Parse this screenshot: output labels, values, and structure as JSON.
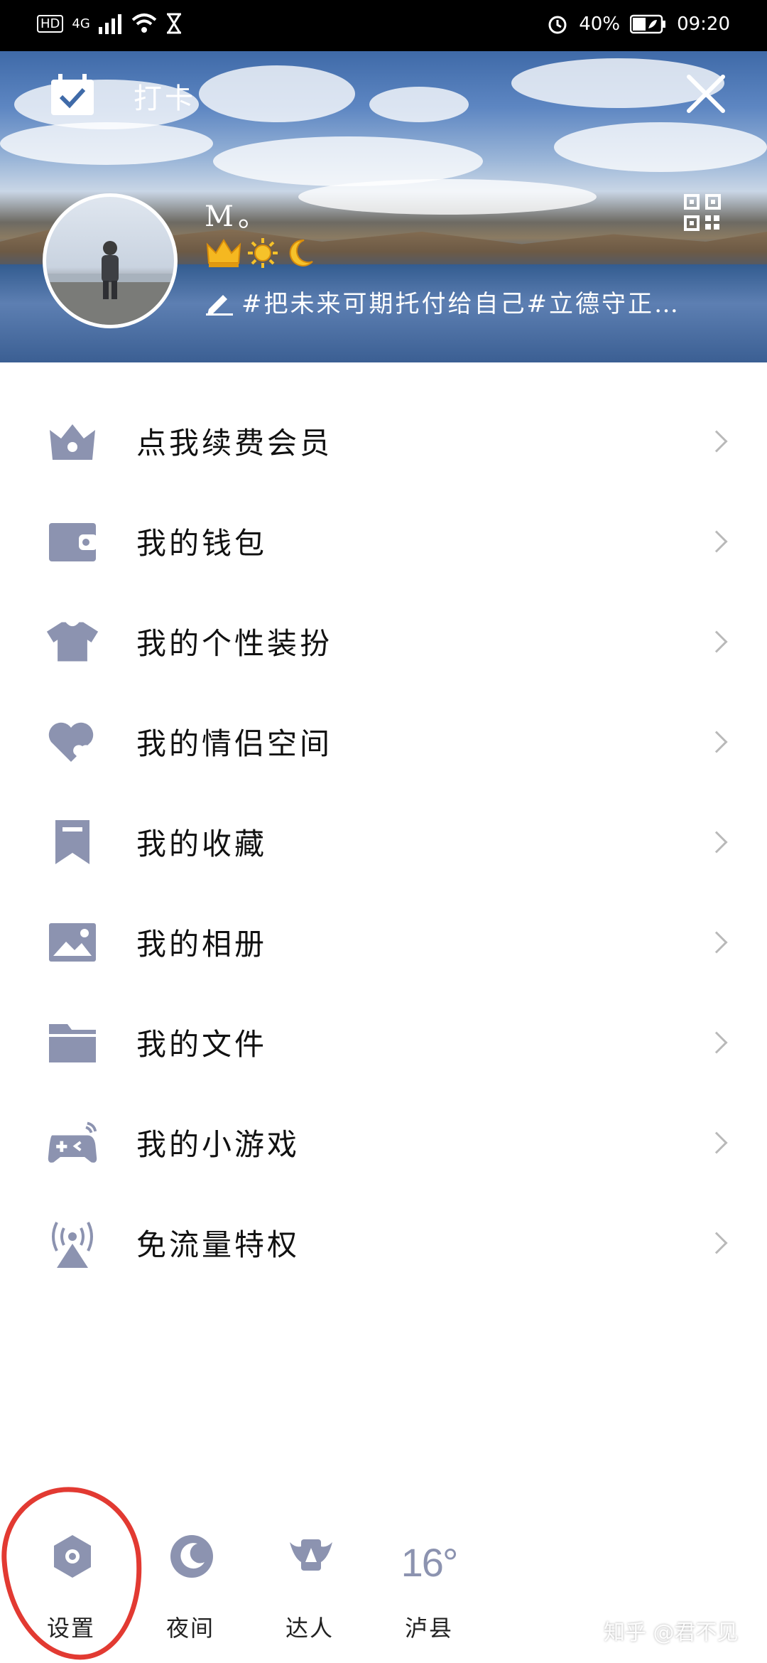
{
  "status_bar": {
    "network": "4G",
    "hd": "HD",
    "battery": "40%",
    "time": "09:20"
  },
  "header": {
    "checkin_label": "打卡",
    "nickname": "M。",
    "signature": "#把未来可期托付给自己#立德守正…"
  },
  "menu": {
    "items": [
      {
        "label": "点我续费会员",
        "icon": "crown-icon"
      },
      {
        "label": "我的钱包",
        "icon": "wallet-icon"
      },
      {
        "label": "我的个性装扮",
        "icon": "tshirt-icon"
      },
      {
        "label": "我的情侣空间",
        "icon": "hearts-icon"
      },
      {
        "label": "我的收藏",
        "icon": "bookmark-icon"
      },
      {
        "label": "我的相册",
        "icon": "photo-icon"
      },
      {
        "label": "我的文件",
        "icon": "folder-icon"
      },
      {
        "label": "我的小游戏",
        "icon": "gamepad-icon"
      },
      {
        "label": "免流量特权",
        "icon": "broadcast-icon"
      }
    ]
  },
  "bottom_bar": {
    "settings_label": "设置",
    "night_label": "夜间",
    "expert_label": "达人",
    "weather_temp": "16°",
    "weather_city": "泸县"
  },
  "watermark": "知乎 @君不见",
  "colors": {
    "icon_gray": "#8c93b0",
    "annotation_red": "#e23a32"
  }
}
